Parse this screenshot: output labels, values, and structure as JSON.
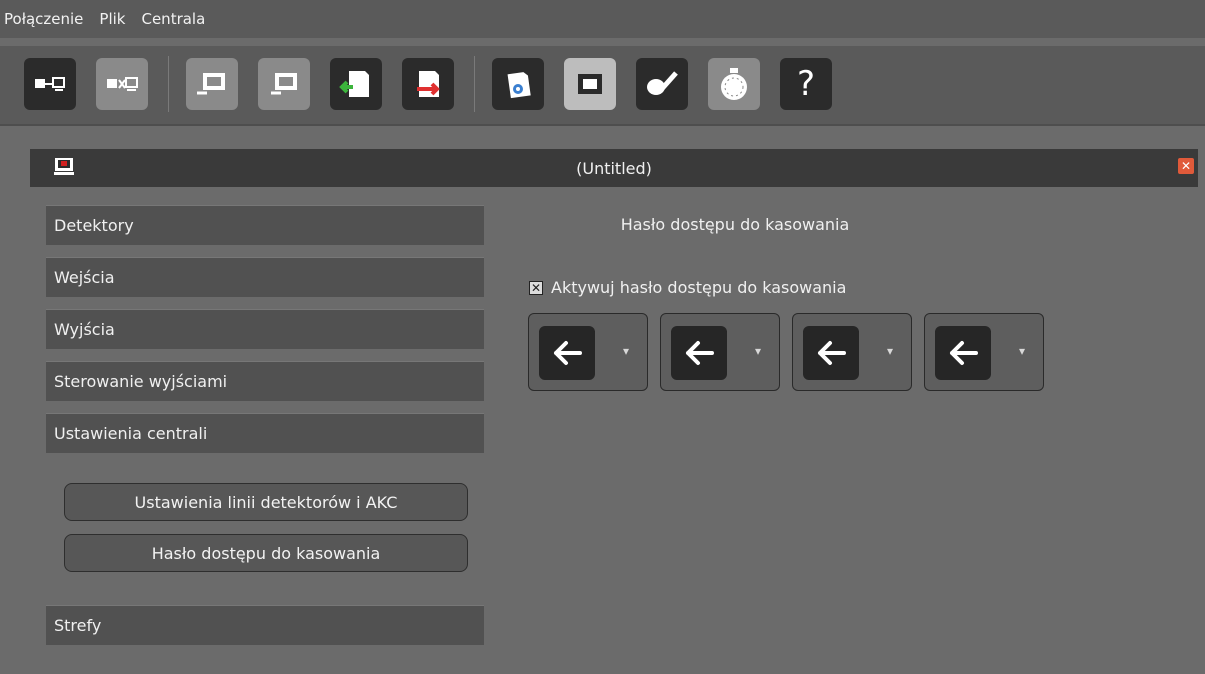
{
  "menu": [
    "Połączenie",
    "Plik",
    "Centrala"
  ],
  "toolbar": {
    "items": [
      {
        "name": "connect-icon"
      },
      {
        "name": "disconnect-icon"
      },
      {
        "name": "read-from-panel-icon"
      },
      {
        "name": "write-to-panel-icon"
      },
      {
        "name": "import-icon"
      },
      {
        "name": "export-icon"
      },
      {
        "name": "settings-document-icon"
      },
      {
        "name": "panel-view-icon"
      },
      {
        "name": "edit-pencil-icon"
      },
      {
        "name": "timer-icon"
      },
      {
        "name": "help-icon",
        "glyph": "?"
      }
    ]
  },
  "window": {
    "title": "(Untitled)",
    "close_glyph": "✕"
  },
  "nav": {
    "items": [
      "Detektory",
      "Wejścia",
      "Wyjścia",
      "Sterowanie wyjściami",
      "Ustawienia centrali"
    ],
    "sub_buttons": [
      "Ustawienia linii detektorów i AKC",
      "Hasło dostępu do kasowania"
    ],
    "last_item": "Strefy"
  },
  "panel": {
    "title": "Hasło dostępu do kasowania",
    "checkbox_label": "Aktywuj hasło dostępu do kasowania",
    "checkbox_checked": true,
    "checkbox_glyph": "✕",
    "digits": [
      "←",
      "←",
      "←",
      "←"
    ],
    "dropdown_glyph": "▾"
  },
  "colors": {
    "close": "#e05a3a",
    "win_icon_red": "#d02020"
  }
}
